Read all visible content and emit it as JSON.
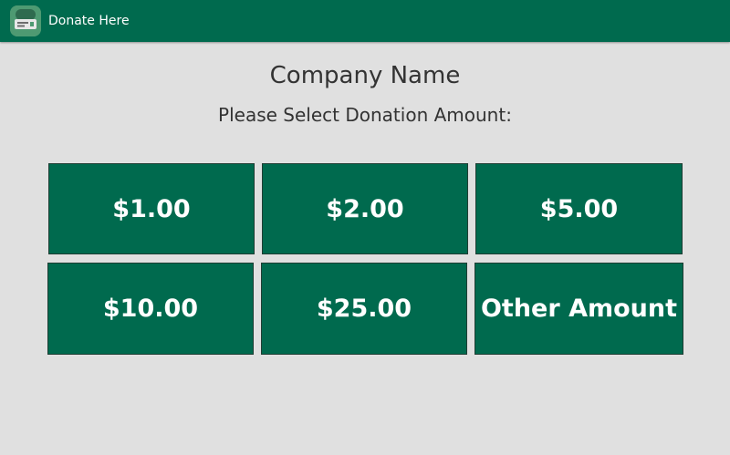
{
  "app_bar": {
    "title": "Donate Here",
    "icon": "donation-app-icon",
    "background_color": "#006a4e"
  },
  "company_name": "Company Name",
  "prompt": "Please Select Donation Amount:",
  "amounts": [
    {
      "label": "$1.00"
    },
    {
      "label": "$2.00"
    },
    {
      "label": "$5.00"
    },
    {
      "label": "$10.00"
    },
    {
      "label": "$25.00"
    },
    {
      "label": "Other Amount"
    }
  ],
  "button_color": "#006a4e"
}
